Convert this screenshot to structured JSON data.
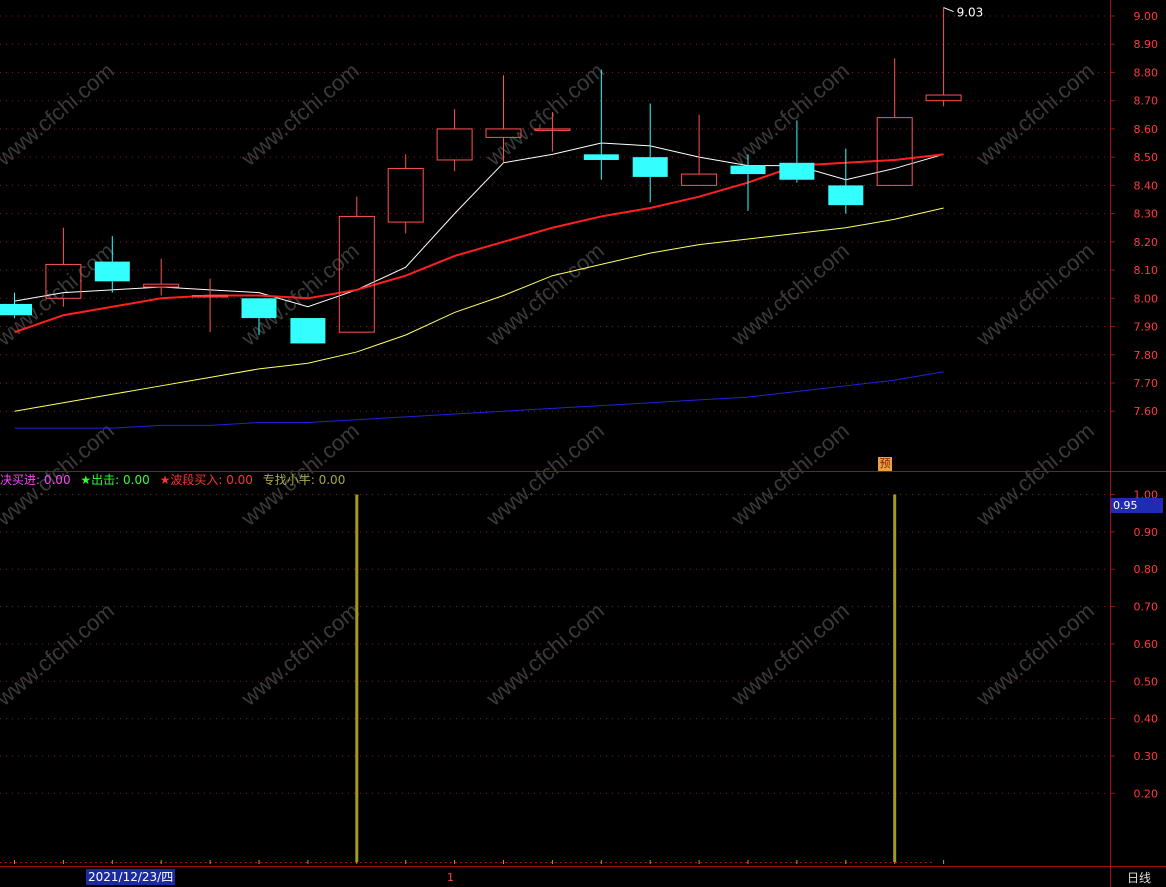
{
  "main_chart": {
    "type": "candlestick",
    "ylim": [
      7.51,
      9.07
    ],
    "y_ticks": [
      "9.00",
      "8.90",
      "8.80",
      "8.70",
      "8.60",
      "8.50",
      "8.40",
      "8.30",
      "8.20",
      "8.10",
      "8.00",
      "7.90",
      "7.80",
      "7.70",
      "7.60"
    ],
    "candles": [
      {
        "open": 7.98,
        "high": 8.02,
        "low": 7.93,
        "close": 7.94
      },
      {
        "open": 8.0,
        "high": 8.25,
        "low": 7.97,
        "close": 8.12
      },
      {
        "open": 8.13,
        "high": 8.22,
        "low": 8.02,
        "close": 8.06
      },
      {
        "open": 8.04,
        "high": 8.14,
        "low": 8.01,
        "close": 8.05
      },
      {
        "open": 8.01,
        "high": 8.07,
        "low": 7.88,
        "close": 8.01
      },
      {
        "open": 8.0,
        "high": 8.0,
        "low": 7.87,
        "close": 7.93
      },
      {
        "open": 7.93,
        "high": 7.93,
        "low": 7.84,
        "close": 7.84
      },
      {
        "open": 7.88,
        "high": 8.36,
        "low": 7.88,
        "close": 8.29
      },
      {
        "open": 8.27,
        "high": 8.51,
        "low": 8.23,
        "close": 8.46
      },
      {
        "open": 8.49,
        "high": 8.67,
        "low": 8.45,
        "close": 8.6
      },
      {
        "open": 8.57,
        "high": 8.79,
        "low": 8.48,
        "close": 8.6
      },
      {
        "open": 8.6,
        "high": 8.66,
        "low": 8.52,
        "close": 8.6
      },
      {
        "open": 8.51,
        "high": 8.81,
        "low": 8.42,
        "close": 8.49
      },
      {
        "open": 8.5,
        "high": 8.69,
        "low": 8.34,
        "close": 8.43
      },
      {
        "open": 8.4,
        "high": 8.65,
        "low": 8.4,
        "close": 8.44
      },
      {
        "open": 8.47,
        "high": 8.51,
        "low": 8.31,
        "close": 8.44
      },
      {
        "open": 8.48,
        "high": 8.63,
        "low": 8.41,
        "close": 8.42
      },
      {
        "open": 8.4,
        "high": 8.53,
        "low": 8.3,
        "close": 8.33
      },
      {
        "open": 8.4,
        "high": 8.85,
        "low": 8.4,
        "close": 8.64
      },
      {
        "open": 8.7,
        "high": 9.03,
        "low": 8.68,
        "close": 8.72
      }
    ],
    "max_label": "9.03",
    "ma_lines": [
      {
        "color": "#ffffff",
        "values": [
          7.99,
          8.02,
          8.03,
          8.04,
          8.03,
          8.02,
          7.97,
          8.03,
          8.11,
          8.3,
          8.48,
          8.51,
          8.55,
          8.54,
          8.5,
          8.47,
          8.47,
          8.42,
          8.46,
          8.51
        ]
      },
      {
        "color": "#ff2020",
        "values": [
          7.88,
          7.94,
          7.97,
          8.0,
          8.01,
          8.01,
          8.0,
          8.03,
          8.08,
          8.15,
          8.2,
          8.25,
          8.29,
          8.32,
          8.36,
          8.41,
          8.47,
          8.48,
          8.49,
          8.51
        ]
      },
      {
        "color": "#ffff66",
        "values": [
          7.6,
          7.63,
          7.66,
          7.69,
          7.72,
          7.75,
          7.77,
          7.81,
          7.87,
          7.95,
          8.01,
          8.08,
          8.12,
          8.16,
          8.19,
          8.21,
          8.23,
          8.25,
          8.28,
          8.32
        ]
      },
      {
        "color": "#2222dd",
        "values": [
          7.54,
          7.54,
          7.54,
          7.55,
          7.55,
          7.56,
          7.56,
          7.57,
          7.58,
          7.59,
          7.6,
          7.61,
          7.62,
          7.63,
          7.64,
          7.65,
          7.67,
          7.69,
          7.71,
          7.74
        ]
      }
    ],
    "up_color": "#ff5252",
    "down_color": "#33ffff",
    "marker_label": "预"
  },
  "indicator": {
    "type": "bar",
    "ylim": [
      0,
      1.02
    ],
    "y_ticks": [
      "1.00",
      "0.90",
      "0.80",
      "0.70",
      "0.60",
      "0.50",
      "0.40",
      "0.30",
      "0.20"
    ],
    "values": [
      0,
      0,
      0,
      0,
      0,
      0,
      0,
      1,
      0,
      0,
      0,
      0,
      0,
      0,
      0,
      0,
      0,
      0,
      1,
      0
    ],
    "bar_color": "#a69a1e",
    "cursor_value": "0.95",
    "legend": [
      {
        "text": "决买进: 0.00",
        "color": "#ff44ff"
      },
      {
        "text": "★出击: 0.00",
        "color": "#33ff33"
      },
      {
        "text": "★波段买入: 0.00",
        "color": "#ff3333"
      },
      {
        "text": "专找小牛: 0.00",
        "color": "#aaaa44"
      }
    ]
  },
  "footer": {
    "date": "2021/12/23/四",
    "period": "日线",
    "marker": "1"
  },
  "watermark": "www.cfchi.com",
  "colors": {
    "axis": "#a01010",
    "grid": "#8a1a1a"
  }
}
